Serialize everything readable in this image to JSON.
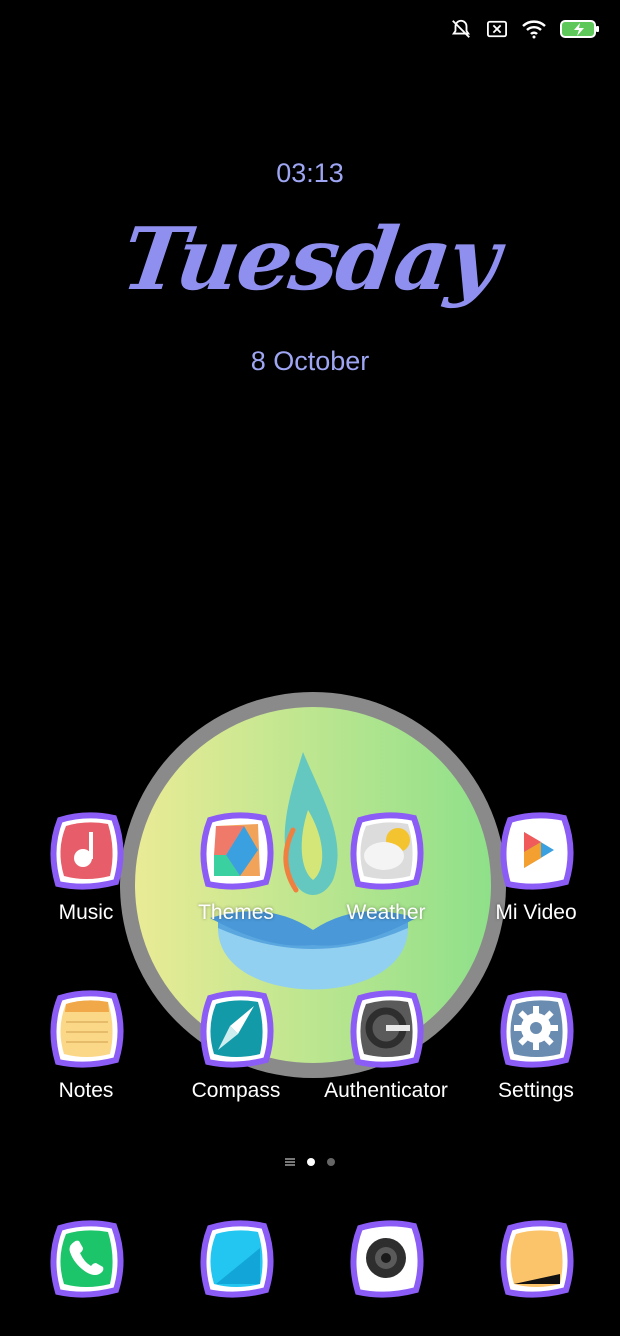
{
  "status_bar": {
    "icons": [
      "vibrate-off-icon",
      "no-sim-icon",
      "wifi-icon",
      "battery-charging-icon"
    ]
  },
  "lockscreen_widget": {
    "time": "03:13",
    "weekday": "Tuesday",
    "date": "8 October"
  },
  "apps_row1": [
    {
      "label": "Music",
      "icon": "music-icon"
    },
    {
      "label": "Themes",
      "icon": "themes-icon"
    },
    {
      "label": "Weather",
      "icon": "weather-icon"
    },
    {
      "label": "Mi Video",
      "icon": "mi-video-icon"
    }
  ],
  "apps_row2": [
    {
      "label": "Notes",
      "icon": "notes-icon"
    },
    {
      "label": "Compass",
      "icon": "compass-icon"
    },
    {
      "label": "Authenticator",
      "icon": "authenticator-icon"
    },
    {
      "label": "Settings",
      "icon": "settings-icon"
    }
  ],
  "page_indicator": {
    "pages": 2,
    "active": 1
  },
  "dock": [
    {
      "icon": "phone-icon"
    },
    {
      "icon": "messaging-icon"
    },
    {
      "icon": "camera-icon"
    },
    {
      "icon": "browser-icon"
    }
  ],
  "colors": {
    "accent": "#9ea6f3",
    "icon_frame": "#8b5cf6"
  }
}
